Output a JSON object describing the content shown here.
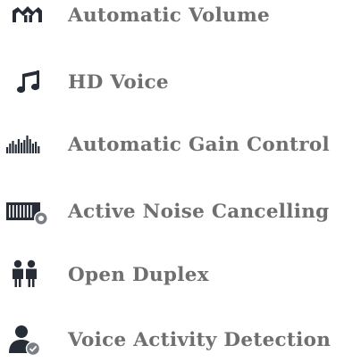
{
  "colors": {
    "icon": "#262d37",
    "label": "#6f6f6f",
    "badge": "#7a7f86"
  },
  "features": [
    {
      "icon": "volume-level-icon",
      "label": "Automatic Volume"
    },
    {
      "icon": "music-note-icon",
      "label": "HD Voice"
    },
    {
      "icon": "equalizer-bars-icon",
      "label": "Automatic Gain Control"
    },
    {
      "icon": "noise-cancel-icon",
      "label": "Active Noise Cancelling"
    },
    {
      "icon": "two-people-icon",
      "label": "Open Duplex"
    },
    {
      "icon": "user-check-icon",
      "label": "Voice Activity Detection"
    }
  ]
}
